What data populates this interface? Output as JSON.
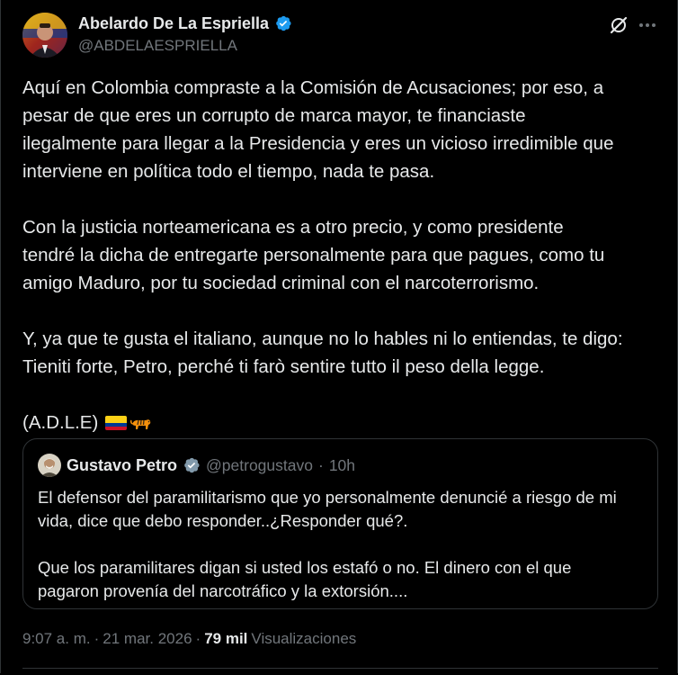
{
  "author": {
    "name": "Abelardo De La Espriella",
    "handle": "@ABDELAESPRIELLA",
    "verified": true,
    "avatar_icon": "avatar-photo"
  },
  "header_icons": [
    "grok-icon",
    "more-icon"
  ],
  "tweet": {
    "paragraphs": [
      {
        "lines": [
          "Aquí en Colombia compraste a la Comisión de Acusaciones; por eso, a",
          "pesar de que eres un corrupto de marca mayor, te financiaste",
          "ilegalmente para llegar a la Presidencia y eres un vicioso irredimible que",
          "interviene en política todo el tiempo, nada te pasa."
        ]
      },
      {
        "lines": [
          "Con la justicia norteamericana es a otro precio, y como presidente",
          "tendré la dicha de entregarte personalmente para que pagues, como tu",
          "amigo Maduro, por tu sociedad criminal con el narcoterrorismo."
        ]
      },
      {
        "lines": [
          "Y, ya que te gusta el italiano, aunque no lo hables ni lo entiendas, te digo:",
          "Tieniti forte, Petro, perché ti farò sentire tutto il peso della legge."
        ]
      }
    ],
    "signature": "(A.D.L.E)",
    "emoji": [
      "flag-colombia-icon",
      "tiger-icon"
    ]
  },
  "quote": {
    "name": "Gustavo Petro",
    "handle": "@petrogustavo",
    "separator": "·",
    "time": "10h",
    "verified": true,
    "paragraphs": [
      {
        "lines": [
          "El defensor del paramilitarismo que yo personalmente denuncié a riesgo de mi",
          "vida, dice que debo responder..¿Responder qué?."
        ]
      },
      {
        "lines": [
          "Que los paramilitares digan si usted los estafó o no. El dinero con el que",
          "pagaron provenía del narcotráfico y la extorsión...."
        ]
      }
    ]
  },
  "footer": {
    "time": "9:07 a. m.",
    "sep1": "·",
    "date": "21 mar. 2026",
    "sep2": "·",
    "views_count": "79 mil",
    "views_label": "Visualizaciones"
  },
  "colors": {
    "background": "#000000",
    "text": "#e7e9ea",
    "muted": "#71767b",
    "border": "#2f3336",
    "verified_blue": "#1d9bf0"
  }
}
